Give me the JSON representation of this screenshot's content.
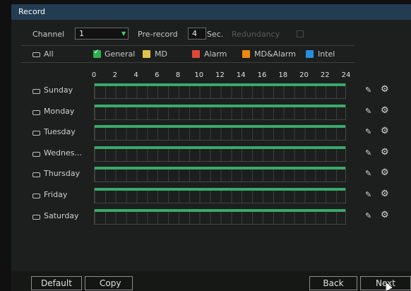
{
  "window": {
    "title": "Record"
  },
  "settings": {
    "channel_label": "Channel",
    "channel_value": "1",
    "prerecord_label": "Pre-record",
    "prerecord_value": "4",
    "prerecord_unit": "Sec.",
    "redundancy_label": "Redundancy"
  },
  "legend": {
    "all_label": "All",
    "items": [
      {
        "label": "General",
        "color": "#2fb34d",
        "checked": true
      },
      {
        "label": "MD",
        "color": "#e2c24a"
      },
      {
        "label": "Alarm",
        "color": "#e0473c"
      },
      {
        "label": "MD&Alarm",
        "color": "#f08a0a"
      },
      {
        "label": "Intel",
        "color": "#2a8ee0"
      }
    ]
  },
  "timeline": {
    "hours": [
      "0",
      "2",
      "4",
      "6",
      "8",
      "10",
      "12",
      "14",
      "16",
      "18",
      "20",
      "22",
      "24"
    ],
    "schedule_color": "#3ba86a"
  },
  "days": [
    {
      "label": "Sunday"
    },
    {
      "label": "Monday"
    },
    {
      "label": "Tuesday"
    },
    {
      "label": "Wednes..."
    },
    {
      "label": "Thursday"
    },
    {
      "label": "Friday"
    },
    {
      "label": "Saturday"
    }
  ],
  "buttons": {
    "default": "Default",
    "copy": "Copy",
    "back": "Back",
    "next": "Next"
  }
}
